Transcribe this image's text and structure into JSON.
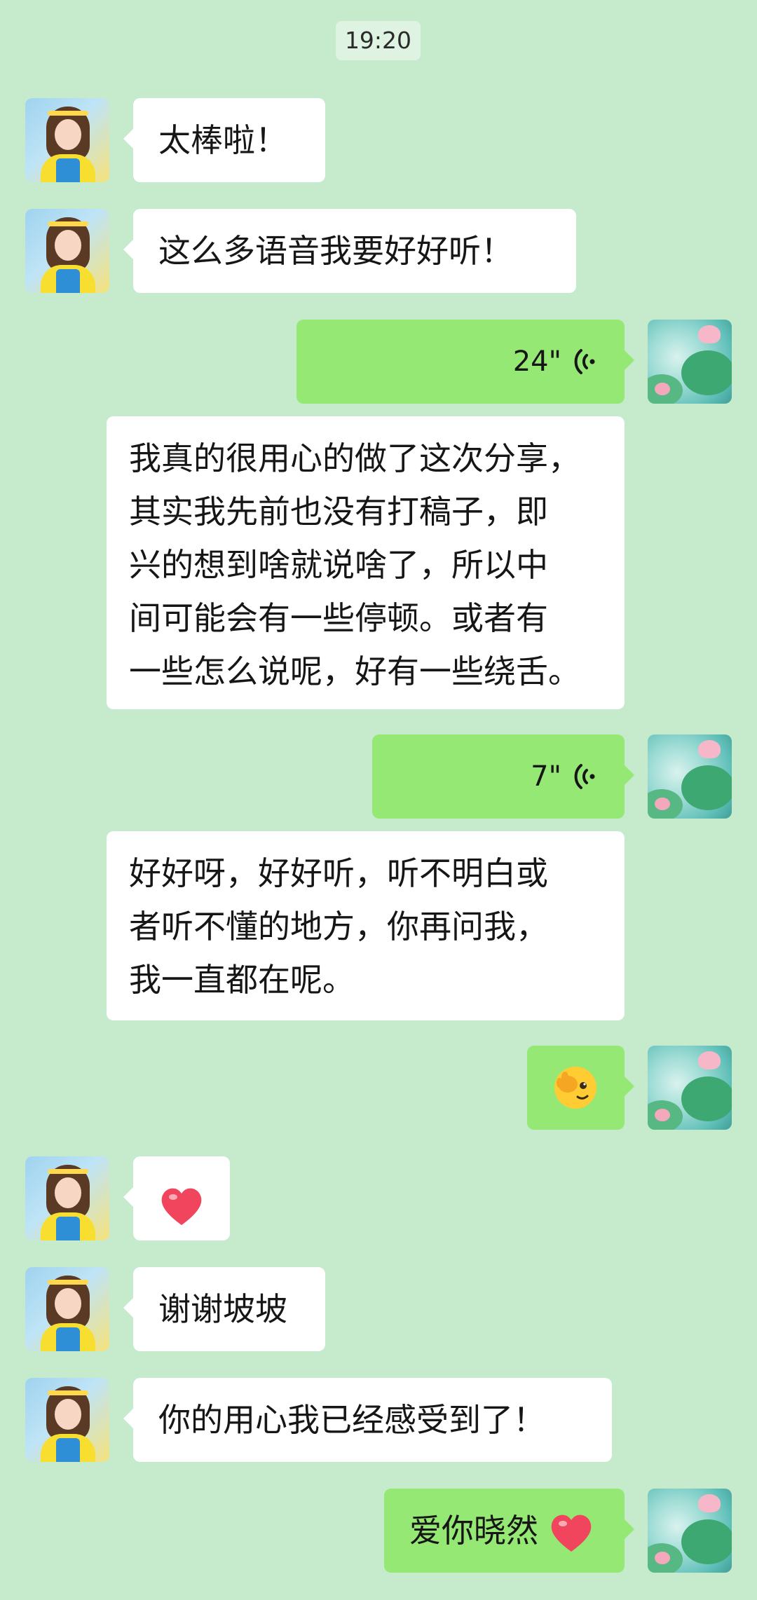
{
  "timestamp": "19:20",
  "messages": [
    {
      "side": "left",
      "type": "text",
      "text": "太棒啦！"
    },
    {
      "side": "left",
      "type": "text",
      "text": "这么多语音我要好好听！"
    },
    {
      "side": "right",
      "type": "voice",
      "duration": "24\""
    },
    {
      "side": "right",
      "type": "text",
      "lines": [
        "我真的很用心的做了这次分享，",
        "其实我先前也没有打稿子，即",
        "兴的想到啥就说啥了，所以中",
        "间可能会有一些停顿。或者有",
        "一些怎么说呢，好有一些绕舌。"
      ]
    },
    {
      "side": "right",
      "type": "voice",
      "duration": "7\""
    },
    {
      "side": "right",
      "type": "text",
      "lines": [
        "好好呀，好好听，听不明白或",
        "者听不懂的地方，你再问我，",
        "我一直都在呢。"
      ]
    },
    {
      "side": "right",
      "type": "emoji",
      "icon": "face-peek-emoji-icon"
    },
    {
      "side": "left",
      "type": "emoji",
      "icon": "red-heart-icon"
    },
    {
      "side": "left",
      "type": "text",
      "text": "谢谢坡坡"
    },
    {
      "side": "left",
      "type": "text",
      "text": "你的用心我已经感受到了！"
    },
    {
      "side": "right",
      "type": "text",
      "text": "爱你晓然",
      "icon": "red-heart-icon"
    }
  ],
  "colors": {
    "background": "#c6ebcc",
    "bubble_self": "#95e873",
    "bubble_other": "#ffffff"
  }
}
